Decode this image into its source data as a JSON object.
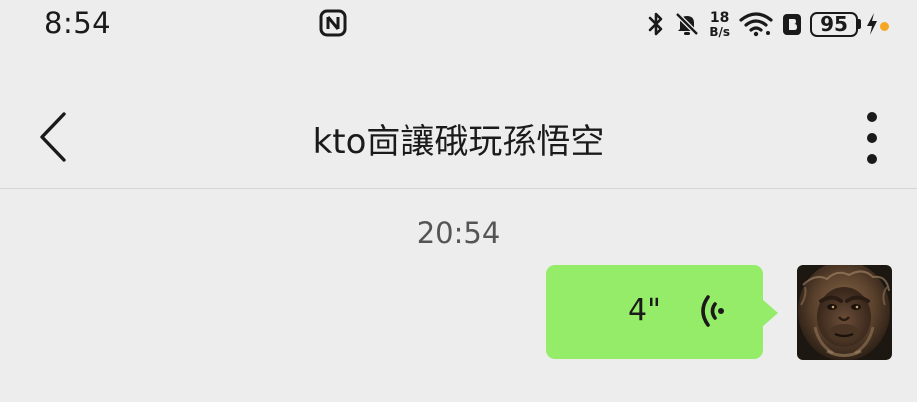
{
  "status_bar": {
    "time": "8:54",
    "net_speed_value": "18",
    "net_speed_unit": "B/s",
    "battery_level": "95",
    "icons": [
      "nfc-icon",
      "bluetooth-icon",
      "bell-off-icon",
      "wifi-icon",
      "data-saver-icon",
      "battery-icon",
      "charging-bolt-icon"
    ],
    "charge_dot_color": "#f5a623"
  },
  "header": {
    "title": "kto㐭讓硪玩孫悟空",
    "back_icon": "chevron-left-icon",
    "more_icon": "more-vertical-icon"
  },
  "chat": {
    "timestamp": "20:54",
    "messages": [
      {
        "type": "voice",
        "sender": "self",
        "duration": "4\"",
        "bubble_color": "#95ec69",
        "icon": "voice-wave-icon",
        "avatar": "monkey-king-avatar"
      }
    ]
  },
  "colors": {
    "background": "#ededed",
    "bubble": "#95ec69",
    "text": "#1a1a1a",
    "muted_text": "#555555"
  }
}
